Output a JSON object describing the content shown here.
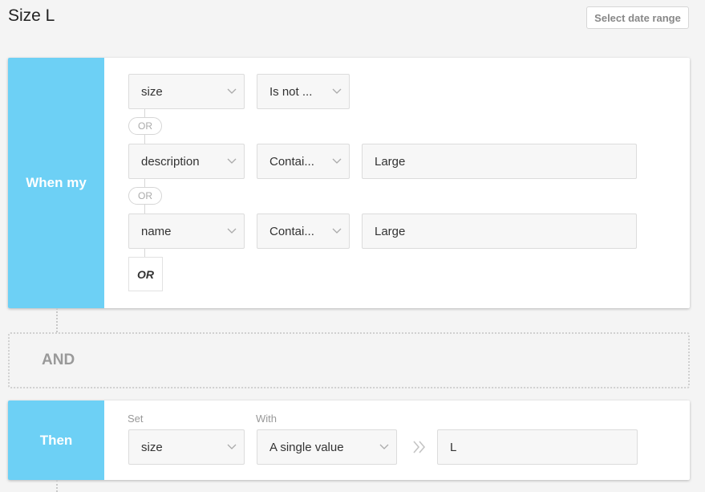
{
  "header": {
    "title": "Size L",
    "date_button": "Select date range"
  },
  "when": {
    "label": "When my",
    "conditions": [
      {
        "field": "size",
        "operator": "Is not ...",
        "value": ""
      },
      {
        "field": "description",
        "operator": "Contai...",
        "value": "Large"
      },
      {
        "field": "name",
        "operator": "Contai...",
        "value": "Large"
      }
    ],
    "connector": "OR",
    "add_or": "OR"
  },
  "and_label": "AND",
  "then": {
    "label": "Then",
    "set_label": "Set",
    "with_label": "With",
    "set_field": "size",
    "with_option": "A single value",
    "value": "L"
  },
  "colors": {
    "accent": "#6dd0f5",
    "background": "#f4f4f4"
  },
  "icons": [
    "chevron-down-icon",
    "double-chevron-right-icon"
  ]
}
